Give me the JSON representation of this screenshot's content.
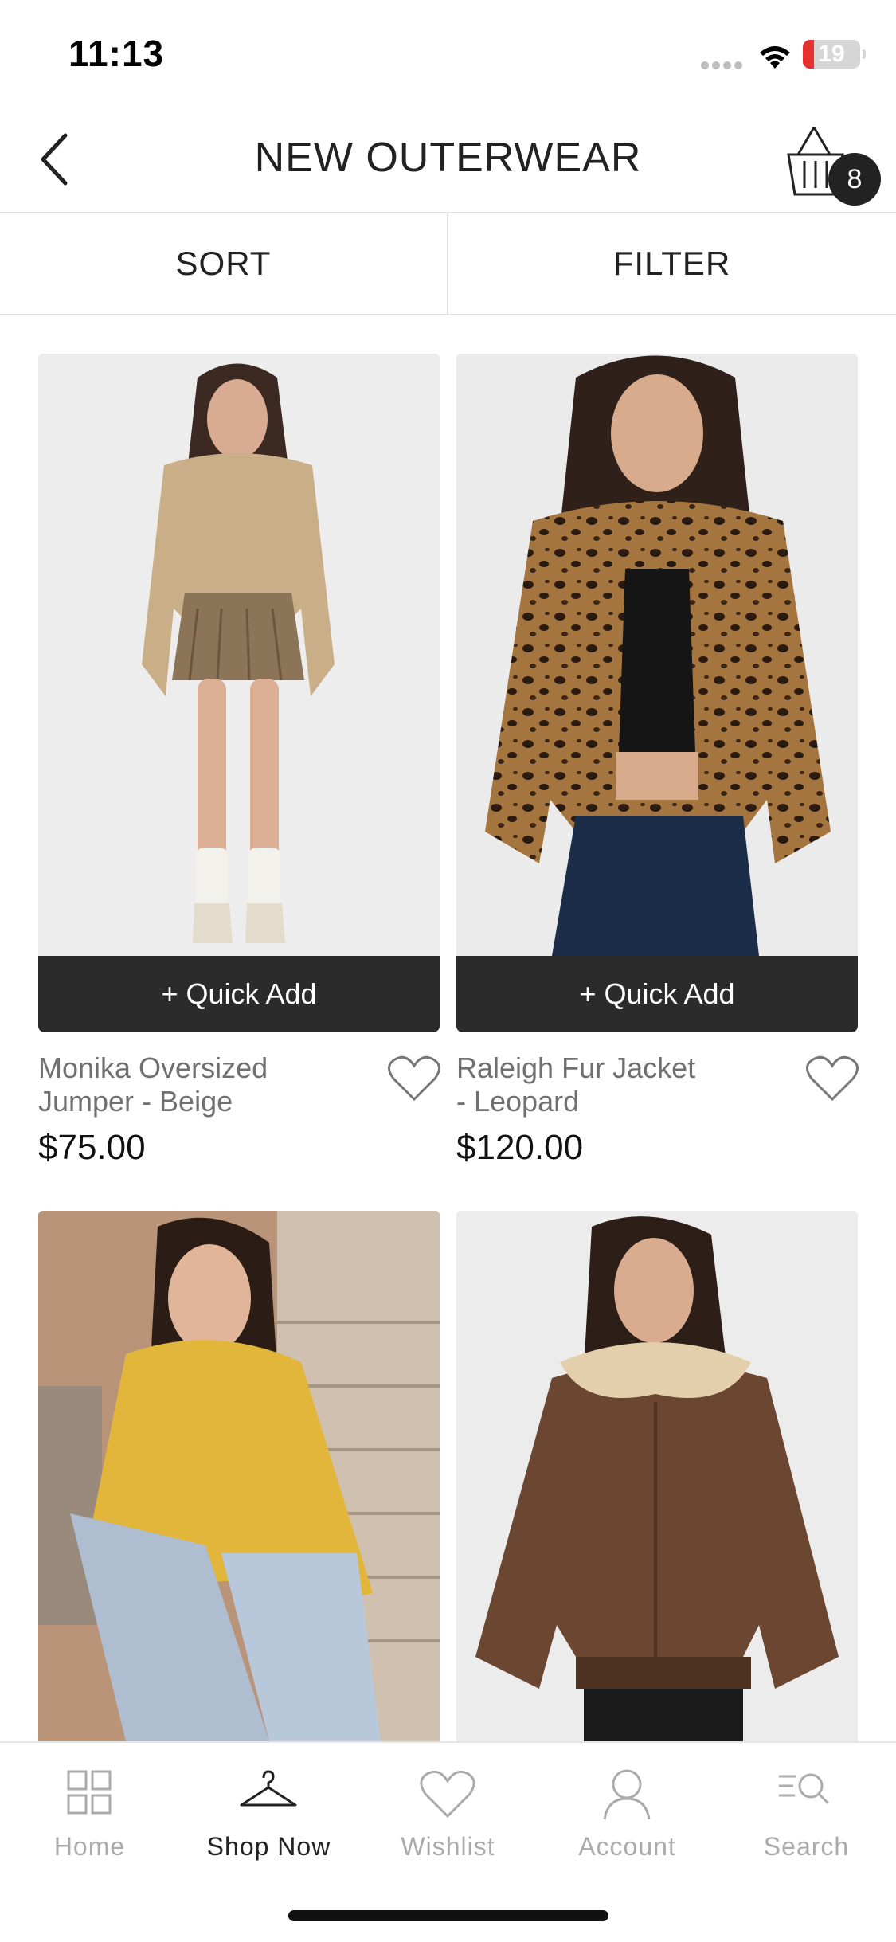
{
  "status_bar": {
    "time": "11:13",
    "battery": "19",
    "battery_level": 0.19,
    "icons": [
      "signal-dots-icon",
      "wifi-icon",
      "battery-icon"
    ]
  },
  "header": {
    "title": "NEW OUTERWEAR",
    "back_icon": "chevron-left-icon",
    "cart_icon": "basket-icon",
    "cart_count": "8"
  },
  "controls": {
    "sort_label": "SORT",
    "filter_label": "FILTER"
  },
  "colors": {
    "quick_add_bg": "#2b2b2b",
    "text_primary": "#222222",
    "text_muted": "#707070",
    "tab_inactive": "#ababab",
    "battery_low": "#e5322f"
  },
  "products": [
    {
      "name_line1": "Monika Oversized",
      "name_line2": "Jumper - Beige",
      "price": "$75.00",
      "quick_add": "+ Quick Add"
    },
    {
      "name_line1": "Raleigh Fur Jacket",
      "name_line2": "- Leopard",
      "price": "$120.00",
      "quick_add": "+ Quick Add"
    },
    {
      "name_line1": "",
      "name_line2": "",
      "price": "",
      "quick_add": ""
    },
    {
      "name_line1": "",
      "name_line2": "",
      "price": "",
      "quick_add": ""
    }
  ],
  "tab_bar": {
    "active": "Shop Now",
    "tabs": [
      {
        "label": "Home",
        "icon": "grid-icon"
      },
      {
        "label": "Shop Now",
        "icon": "hanger-icon"
      },
      {
        "label": "Wishlist",
        "icon": "heart-icon"
      },
      {
        "label": "Account",
        "icon": "user-icon"
      },
      {
        "label": "Search",
        "icon": "search-list-icon"
      }
    ]
  }
}
